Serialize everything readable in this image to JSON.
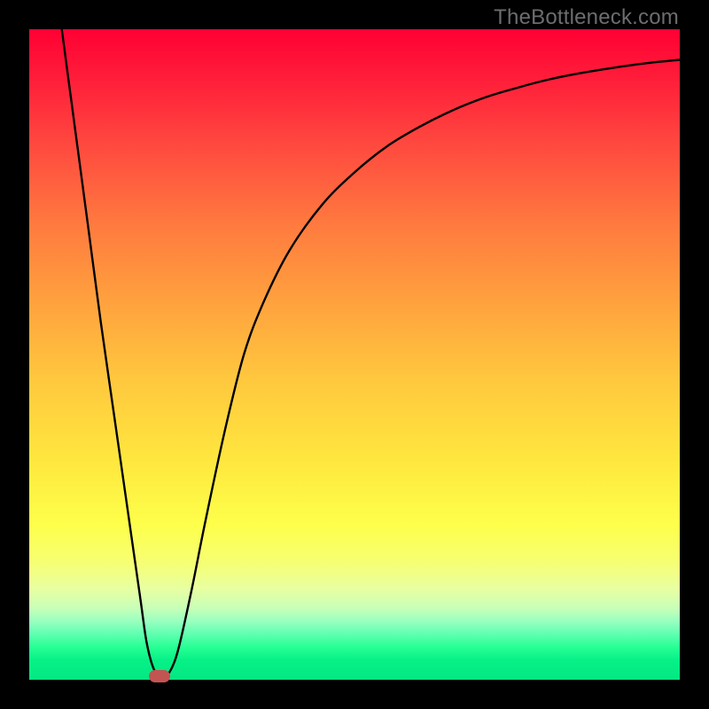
{
  "watermark": "TheBottleneck.com",
  "colors": {
    "frame": "#000000",
    "watermark": "#6d6d6d",
    "curve": "#000000",
    "marker": "#c25451",
    "gradient_top": "#ff0033",
    "gradient_bottom": "#05e783"
  },
  "chart_data": {
    "type": "line",
    "title": "",
    "xlabel": "",
    "ylabel": "",
    "xlim": [
      0,
      100
    ],
    "ylim": [
      0,
      100
    ],
    "grid": false,
    "legend": false,
    "series": [
      {
        "name": "curve",
        "x": [
          5,
          7,
          9,
          11,
          13,
          15,
          17,
          18,
          19,
          20,
          21,
          22,
          23,
          25,
          27,
          30,
          33,
          36,
          40,
          45,
          50,
          55,
          60,
          65,
          70,
          75,
          80,
          85,
          90,
          95,
          100
        ],
        "y": [
          100,
          85,
          70,
          55,
          41,
          27,
          13,
          6,
          2,
          0.5,
          0.5,
          2,
          5,
          14,
          24,
          38,
          50,
          58,
          66,
          73,
          78,
          82,
          85,
          87.5,
          89.5,
          91,
          92.3,
          93.3,
          94.1,
          94.8,
          95.3
        ]
      }
    ],
    "marker": {
      "x": 20,
      "y": 0.5,
      "label": ""
    },
    "annotations": []
  }
}
